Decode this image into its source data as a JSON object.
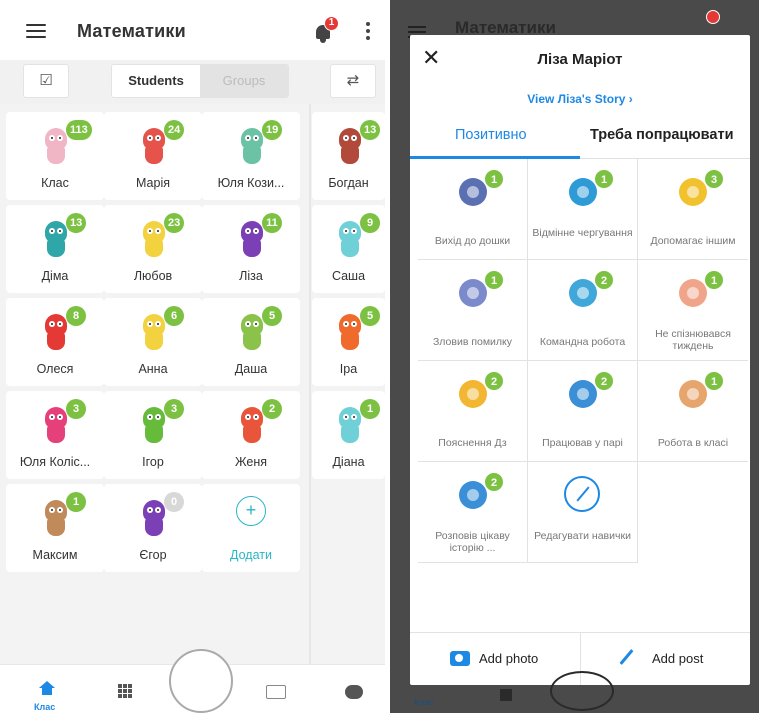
{
  "left_screen": {
    "app_title": "Математики",
    "notifications_count": "1",
    "toolbar": {
      "students_tab": "Students",
      "groups_tab": "Groups"
    },
    "students": [
      {
        "name": "Клас",
        "points": "113",
        "color": "#f0b6c6"
      },
      {
        "name": "Марія",
        "points": "24",
        "color": "#e5534b"
      },
      {
        "name": "Юля Кози...",
        "points": "19",
        "color": "#6cc2a4"
      },
      {
        "name": "Богдан",
        "points": "13",
        "color": "#b24a3b"
      },
      {
        "name": "Діма",
        "points": "13",
        "color": "#2fa6a8"
      },
      {
        "name": "Любов",
        "points": "23",
        "color": "#f2d33f"
      },
      {
        "name": "Ліза",
        "points": "11",
        "color": "#7b3fb6"
      },
      {
        "name": "Саша",
        "points": "9",
        "color": "#6fd0d8"
      },
      {
        "name": "Олеся",
        "points": "8",
        "color": "#e53935"
      },
      {
        "name": "Анна",
        "points": "6",
        "color": "#f2d33f"
      },
      {
        "name": "Даша",
        "points": "5",
        "color": "#8bc34a"
      },
      {
        "name": "Іра",
        "points": "5",
        "color": "#f06a2c"
      },
      {
        "name": "Юля Коліс...",
        "points": "3",
        "color": "#e6407a"
      },
      {
        "name": "Ігор",
        "points": "3",
        "color": "#66bb3a"
      },
      {
        "name": "Женя",
        "points": "2",
        "color": "#e8553a"
      },
      {
        "name": "Діана",
        "points": "1",
        "color": "#6fd0d8"
      },
      {
        "name": "Максим",
        "points": "1",
        "color": "#c08a5a"
      },
      {
        "name": "Єгор",
        "points": "0",
        "color": "#7b3fb6"
      }
    ],
    "add_label": "Додати",
    "bottom_nav": {
      "home_label": "Клас"
    }
  },
  "modal": {
    "background_title": "Математики",
    "student_name": "Ліза Маріот",
    "story_link": "View Лiза's Story ›",
    "tabs": [
      "Позитивно",
      "Треба попрацювати"
    ],
    "skills": [
      {
        "label": "Вихід до дошки",
        "points": "1",
        "icon": "microphone-icon",
        "color": "#5b6fb3"
      },
      {
        "label": "Відмінне чергування",
        "points": "1",
        "icon": "checkbox-icon",
        "color": "#2e9ad6"
      },
      {
        "label": "Допомагає іншим",
        "points": "3",
        "icon": "crown-icon",
        "color": "#f2c12e"
      },
      {
        "label": "Зловив помилку",
        "points": "1",
        "icon": "megaphone-icon",
        "color": "#7a8acb"
      },
      {
        "label": "Командна робота",
        "points": "2",
        "icon": "team-icon",
        "color": "#3fa7d9"
      },
      {
        "label": "Не спізнювався тиждень",
        "points": "1",
        "icon": "foot-icon",
        "color": "#f0a58a"
      },
      {
        "label": "Пояснення Дз",
        "points": "2",
        "icon": "medal-icon",
        "color": "#f2b632"
      },
      {
        "label": "Працював у парі",
        "points": "2",
        "icon": "globe-icon",
        "color": "#3a8fd6"
      },
      {
        "label": "Робота в класі",
        "points": "1",
        "icon": "handshake-icon",
        "color": "#e7a56e"
      },
      {
        "label": "Розповів цікаву історію ...",
        "points": "2",
        "icon": "magnifier-icon",
        "color": "#3a8fd6"
      },
      {
        "label": "Редагувати навички",
        "points": "",
        "icon": "edit-icon",
        "color": "#1e88e5"
      }
    ],
    "add_photo": "Add photo",
    "add_post": "Add post",
    "bottom_home_label": "Клас"
  }
}
